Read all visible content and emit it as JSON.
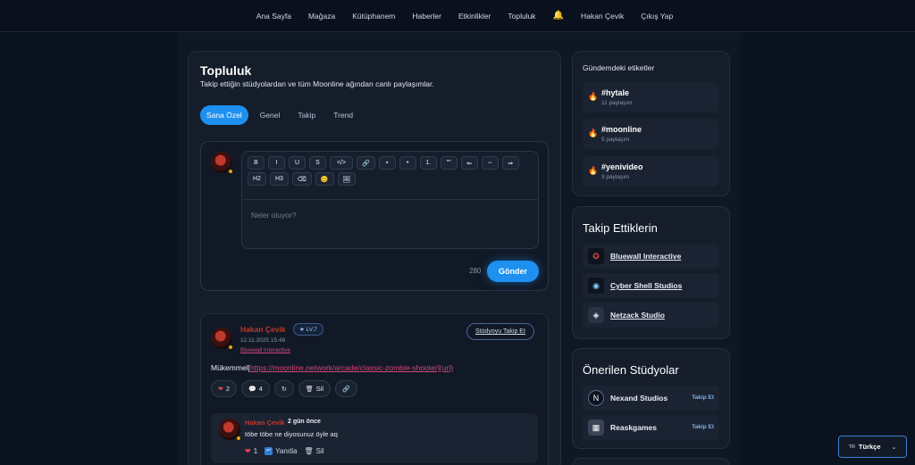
{
  "nav": {
    "items": [
      "Ana Sayfa",
      "Mağaza",
      "Kütüphanem",
      "Haberler",
      "Etkinlikler",
      "Topluluk"
    ],
    "bell_icon": "bell-icon",
    "user_name": "Hakan Çevik",
    "logout": "Çıkış Yap"
  },
  "main": {
    "title": "Topluluk",
    "subtitle": "Takip ettiğin stüdyolardan ve tüm Moonline ağından canlı paylaşımlar.",
    "tabs": [
      "Sana Özel",
      "Genel",
      "Takip",
      "Trend"
    ],
    "active_tab": "Sana Özel"
  },
  "composer": {
    "toolbar": [
      "B",
      "I",
      "U",
      "S",
      "</>",
      "🔗",
      "▪",
      "•",
      "1.",
      "\"\"",
      "⇐",
      "⇔",
      "⇒",
      "H2",
      "H3",
      "⌫",
      "😊",
      "🖼"
    ],
    "placeholder": "Neler oluyor?",
    "char_count": "280",
    "send_label": "Gönder"
  },
  "post": {
    "author": "Hakan Çevik",
    "level": "★ LV.7",
    "date": "12.11.2025 15:48",
    "studio": "Bluewall Interactive",
    "follow_label": "Stüdyoyu Takip Et",
    "body_prefix": "Mükemmel[",
    "body_link": "https://moonline.network/arcade/classic-zombie-shooter](url)",
    "likes": "2",
    "comments": "4",
    "delete_label": "Sil",
    "reply": {
      "author": "Hakan Çevik",
      "time": "2 gün önce",
      "text": "töbe töbe ne diyosunuz öyle aq",
      "likes": "1",
      "reply_label": "Yanıtla",
      "delete_label": "Sil"
    }
  },
  "trending": {
    "title": "Gündemdeki etiketler",
    "items": [
      {
        "tag": "#hytale",
        "count": "11 paylaşım"
      },
      {
        "tag": "#moonline",
        "count": "5 paylaşım"
      },
      {
        "tag": "#yenivideo",
        "count": "3 paylaşım"
      }
    ]
  },
  "following": {
    "title": "Takip Ettiklerin",
    "items": [
      "Bluewall Interactive",
      "Cyber Shell Studios",
      "Netzack Studio"
    ]
  },
  "recommended": {
    "title": "Önerilen Stüdyolar",
    "items": [
      {
        "name": "Nexand Studios",
        "action": "Takip Et"
      },
      {
        "name": "Reaskgames",
        "action": "Takip Et"
      }
    ]
  },
  "language": {
    "flag": "TR",
    "label": "Türkçe"
  },
  "colors": {
    "accent": "#1e90f0",
    "author": "#c0392b",
    "link": "#d04a78"
  }
}
